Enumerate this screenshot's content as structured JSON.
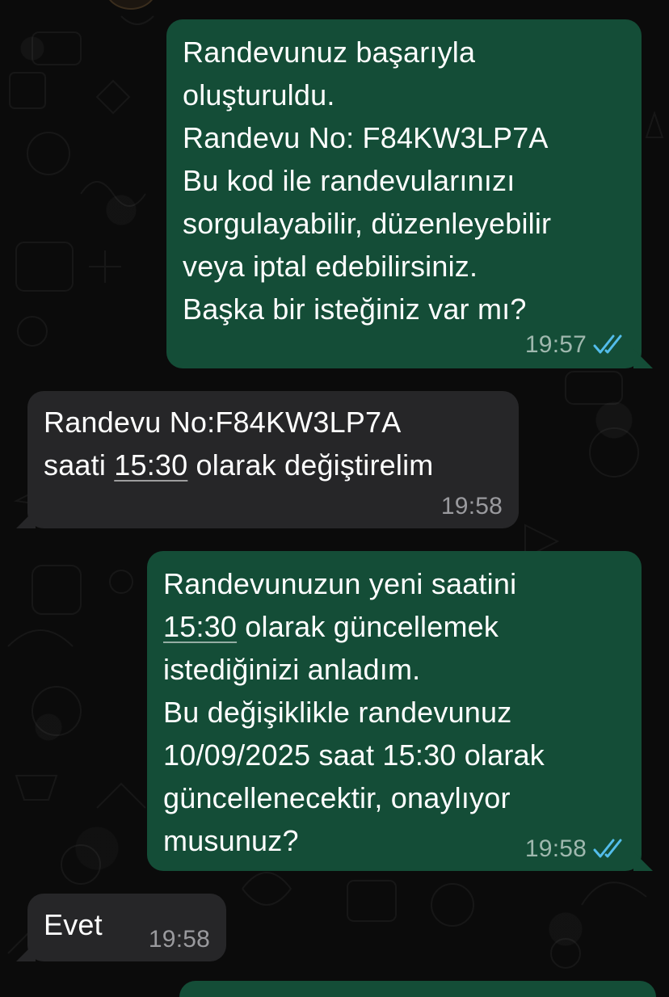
{
  "messages": [
    {
      "direction": "outgoing",
      "lines": [
        "Randevunuz başarıyla",
        "oluşturuldu.",
        "Randevu No: F84KW3LP7A",
        "Bu kod ile randevularınızı",
        "sorgulayabilir, düzenleyebilir",
        "veya iptal edebilirsiniz.",
        "Başka bir isteğiniz var mı?"
      ],
      "time": "19:57",
      "status": "read",
      "status_icon": "double-check-icon"
    },
    {
      "direction": "incoming",
      "line1": "Randevu No:F84KW3LP7A",
      "line2_prefix": "saati ",
      "line2_link": "15:30",
      "line2_suffix": " olarak değiştirelim",
      "time": "19:58"
    },
    {
      "direction": "outgoing",
      "line1": "Randevunuzun yeni saatini",
      "line2_link": "15:30",
      "line2_suffix": " olarak güncellemek",
      "lines_rest": [
        "istediğinizi anladım.",
        "Bu değişiklikle randevunuz",
        "10/09/2025 saat 15:30 olarak",
        "güncellenecektir, onaylıyor",
        "musunuz?"
      ],
      "time": "19:58",
      "status": "read",
      "status_icon": "double-check-icon"
    },
    {
      "direction": "incoming",
      "text": "Evet",
      "time": "19:58"
    }
  ],
  "colors": {
    "background": "#0b0b0b",
    "outgoing_bubble": "#144d37",
    "incoming_bubble": "#262628",
    "read_ticks": "#53bdeb"
  }
}
